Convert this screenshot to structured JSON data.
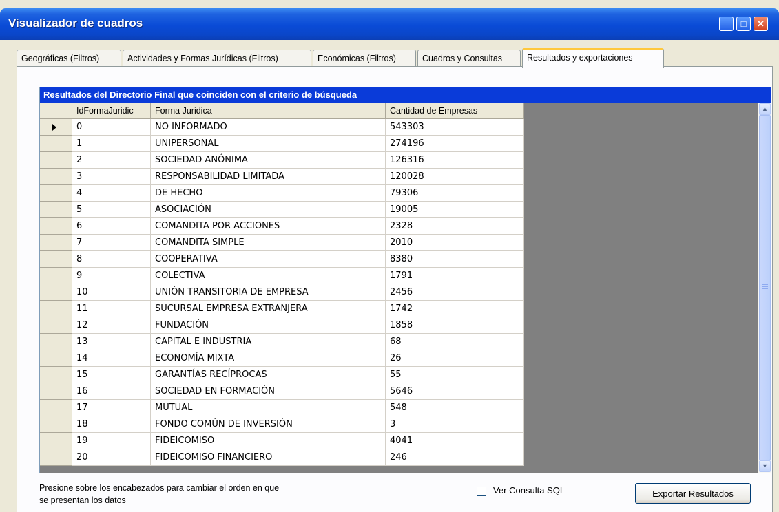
{
  "window": {
    "title": "Visualizador de cuadros",
    "minimize": "_",
    "maximize": "□",
    "close": "✕"
  },
  "tabs": [
    {
      "label": "Geográficas (Filtros)"
    },
    {
      "label": "Actividades y Formas Jurídicas (Filtros)"
    },
    {
      "label": "Económicas (Filtros)"
    },
    {
      "label": "Cuadros y Consultas"
    },
    {
      "label": "Resultados y exportaciones",
      "active": true
    }
  ],
  "grid": {
    "caption": "Resultados del Directorio Final que coinciden con el criterio de búsqueda",
    "columns": [
      "IdFormaJuridic",
      "Forma Juridica",
      "Cantidad de Empresas"
    ],
    "rows": [
      [
        "0",
        "NO INFORMADO",
        "543303"
      ],
      [
        "1",
        "UNIPERSONAL",
        "274196"
      ],
      [
        "2",
        "SOCIEDAD ANÓNIMA",
        "126316"
      ],
      [
        "3",
        "RESPONSABILIDAD LIMITADA",
        "120028"
      ],
      [
        "4",
        "DE HECHO",
        "79306"
      ],
      [
        "5",
        "ASOCIACIÓN",
        "19005"
      ],
      [
        "6",
        "COMANDITA POR ACCIONES",
        "2328"
      ],
      [
        "7",
        "COMANDITA SIMPLE",
        "2010"
      ],
      [
        "8",
        "COOPERATIVA",
        "8380"
      ],
      [
        "9",
        "COLECTIVA",
        "1791"
      ],
      [
        "10",
        "UNIÓN TRANSITORIA DE EMPRESA",
        "2456"
      ],
      [
        "11",
        "SUCURSAL EMPRESA EXTRANJERA",
        "1742"
      ],
      [
        "12",
        "FUNDACIÓN",
        "1858"
      ],
      [
        "13",
        "CAPITAL E INDUSTRIA",
        "68"
      ],
      [
        "14",
        "ECONOMÍA MIXTA",
        "26"
      ],
      [
        "15",
        "GARANTÍAS RECÍPROCAS",
        "55"
      ],
      [
        "16",
        "SOCIEDAD EN FORMACIÓN",
        "5646"
      ],
      [
        "17",
        "MUTUAL",
        "548"
      ],
      [
        "18",
        "FONDO COMÚN DE INVERSIÓN",
        "3"
      ],
      [
        "19",
        "FIDEICOMISO",
        "4041"
      ],
      [
        "20",
        "FIDEICOMISO FINANCIERO",
        "246"
      ]
    ],
    "selected_row": 0
  },
  "footer": {
    "hint": "Presione sobre los encabezados para cambiar el orden en que se presentan los datos",
    "sql_checkbox_label": "Ver Consulta SQL",
    "sql_checkbox_checked": false,
    "export_button": "Exportar Resultados"
  },
  "colors": {
    "caption_bar": "#0a3bd9",
    "grid_empty_area": "#808080",
    "active_tab_highlight": "#ffc83c"
  }
}
